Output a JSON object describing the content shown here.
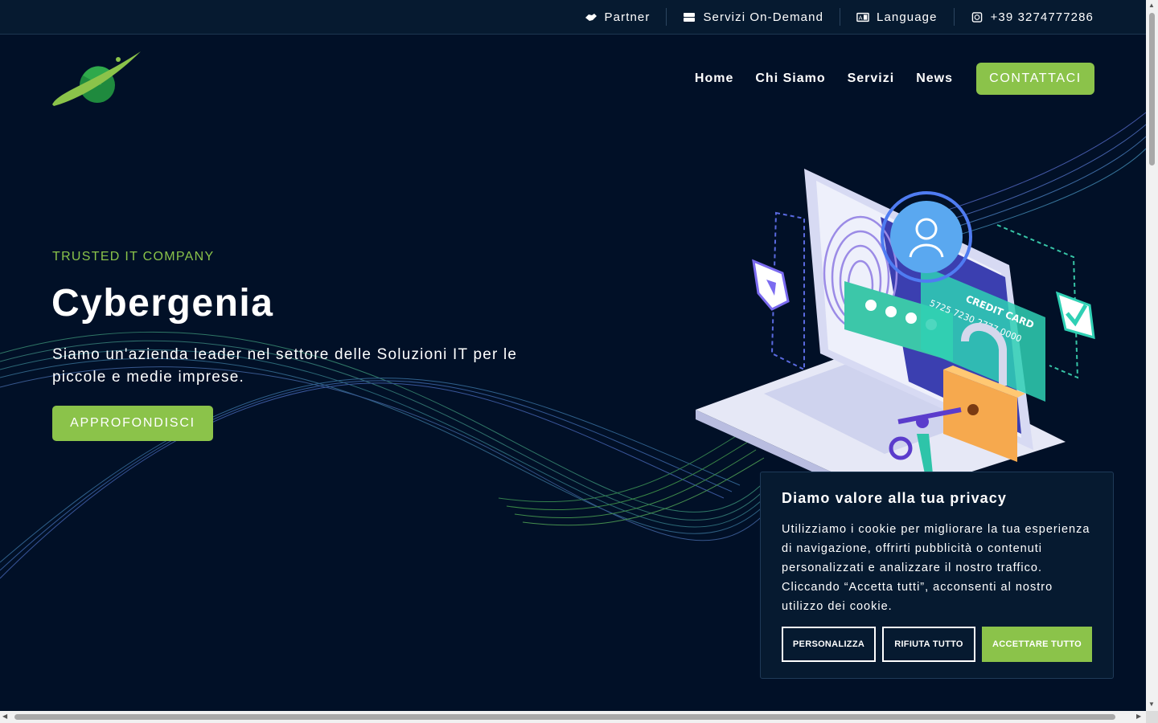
{
  "topbar": {
    "items": [
      {
        "label": "Partner",
        "icon": "handshake-icon"
      },
      {
        "label": "Servizi On-Demand",
        "icon": "server-icon"
      },
      {
        "label": "Language",
        "icon": "language-icon"
      },
      {
        "label": "+39 3274777286",
        "icon": "whatsapp-icon"
      }
    ]
  },
  "header": {
    "logo": "planet-logo",
    "nav": [
      "Home",
      "Chi Siamo",
      "Servizi",
      "News"
    ],
    "cta_label": "CONTATTACI"
  },
  "hero": {
    "eyebrow": "TRUSTED IT COMPANY",
    "title": "Cybergenia",
    "subtitle": "Siamo un'azienda leader nel settore delle Soluzioni IT per le piccole e medie imprese.",
    "button_label": "APPROFONDISCI",
    "illustration": "laptop-security-illustration",
    "card_text": "CREDIT CARD",
    "card_number": "5725 7230 2777 0000"
  },
  "cookie_banner": {
    "title": "Diamo valore alla tua privacy",
    "text": "Utilizziamo i cookie per migliorare la tua esperienza di navigazione, offrirti pubblicità o contenuti personalizzati e analizzare il nostro traffico. Cliccando “Accetta tutti”, acconsenti al nostro utilizzo dei cookie.",
    "buttons": {
      "customize": "PERSONALIZZA",
      "reject": "RIFIUTA TUTTO",
      "accept": "ACCETTARE TUTTO"
    }
  },
  "colors": {
    "background": "#011027",
    "accent": "#8bc34a",
    "topbar": "#061a30"
  }
}
